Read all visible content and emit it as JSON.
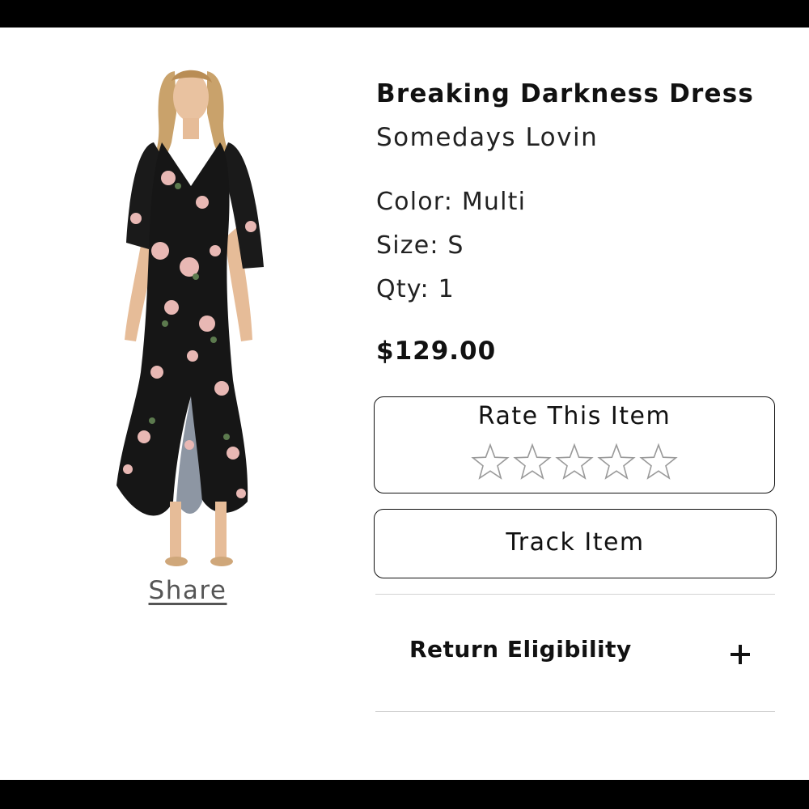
{
  "product": {
    "title": "Breaking Darkness Dress",
    "brand": "Somedays Lovin",
    "color": "Color: Multi",
    "size": "Size: S",
    "qty": "Qty: 1",
    "price": "$129.00",
    "image_icon": "floral-maxi-dress-photo"
  },
  "share": {
    "label": "Share"
  },
  "rating": {
    "title": "Rate This Item",
    "max_stars": 5,
    "value": 0,
    "star_icon": "star-outline-icon"
  },
  "track": {
    "label": "Track Item"
  },
  "returns": {
    "label": "Return Eligibility",
    "expand_icon": "plus-icon"
  },
  "colors": {
    "text": "#111111",
    "muted": "#555555",
    "divider": "#d2d2d2",
    "frame_bar": "#000000",
    "star_stroke": "#9a9a9a"
  }
}
